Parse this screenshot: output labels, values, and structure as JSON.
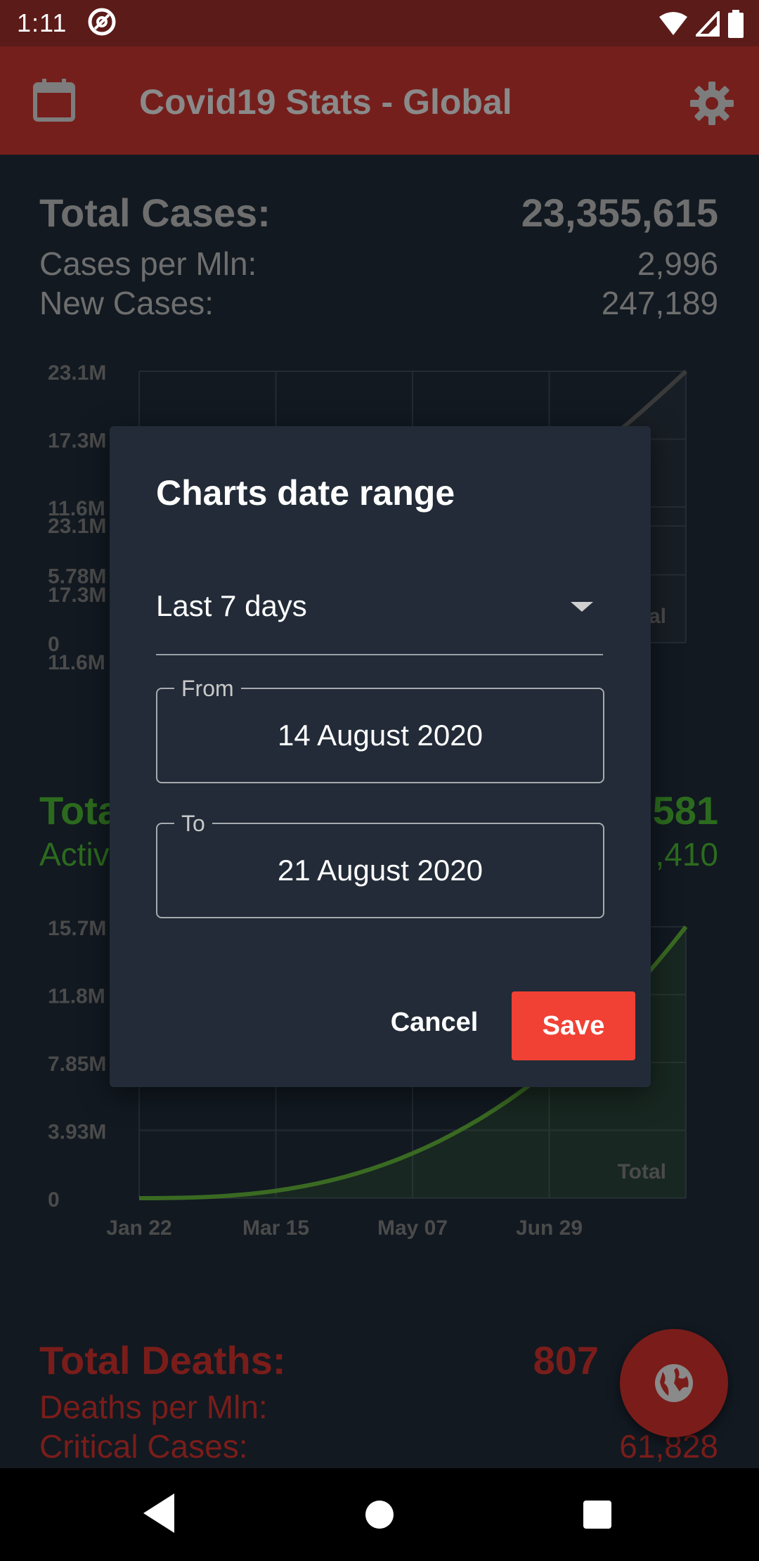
{
  "status_bar": {
    "time": "1:11"
  },
  "app_bar": {
    "title": "Covid19 Stats - Global"
  },
  "cases": {
    "total_label": "Total Cases:",
    "total_value": "23,355,615",
    "per_mln_label": "Cases per Mln:",
    "per_mln_value": "2,996",
    "new_label": "New Cases:",
    "new_value": "247,189"
  },
  "active": {
    "total_label_partial": "Tota",
    "total_value_partial": "581",
    "active_label_partial": "Activ",
    "active_value_partial": ",410"
  },
  "deaths": {
    "total_label": "Total Deaths:",
    "total_value_partial": "807",
    "per_mln_label": "Deaths per Mln:",
    "critical_label": "Critical Cases:",
    "critical_value": "61,828"
  },
  "chart_data": [
    {
      "type": "area",
      "y_ticks": [
        "23.1M",
        "17.3M",
        "11.6M",
        "5.78M",
        "0"
      ],
      "legend_partial": "al",
      "ylim": [
        0,
        23100000
      ]
    },
    {
      "type": "area",
      "y_ticks": [
        "15.7M",
        "11.8M",
        "7.85M",
        "3.93M",
        "0"
      ],
      "x_ticks": [
        "Jan 22",
        "Mar 15",
        "May 07",
        "Jun 29"
      ],
      "legend": "Total",
      "ylim": [
        0,
        15700000
      ],
      "colors": {
        "series": "#3a6a22"
      }
    }
  ],
  "dialog": {
    "title": "Charts date range",
    "range_selected": "Last 7 days",
    "from_label": "From",
    "from_value": "14 August 2020",
    "to_label": "To",
    "to_value": "21 August 2020",
    "cancel_label": "Cancel",
    "save_label": "Save"
  },
  "colors": {
    "accent": "#f04134",
    "app_bar": "#751f1c",
    "dialog_bg": "#222b37"
  }
}
